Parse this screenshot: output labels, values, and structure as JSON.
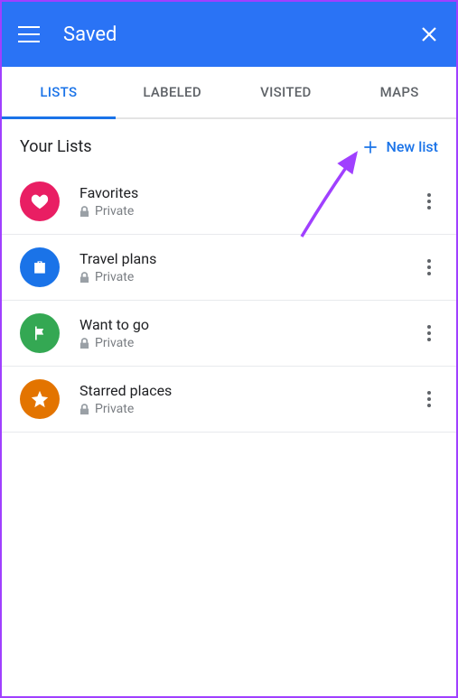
{
  "header": {
    "title": "Saved"
  },
  "tabs": [
    {
      "label": "LISTS",
      "active": true
    },
    {
      "label": "LABELED",
      "active": false
    },
    {
      "label": "VISITED",
      "active": false
    },
    {
      "label": "MAPS",
      "active": false
    }
  ],
  "section": {
    "title": "Your Lists",
    "new_list_label": "New list"
  },
  "lists": [
    {
      "name": "Favorites",
      "privacy": "Private",
      "icon": "heart",
      "color": "#e91e63"
    },
    {
      "name": "Travel plans",
      "privacy": "Private",
      "icon": "suitcase",
      "color": "#1a73e8"
    },
    {
      "name": "Want to go",
      "privacy": "Private",
      "icon": "flag",
      "color": "#34a853"
    },
    {
      "name": "Starred places",
      "privacy": "Private",
      "icon": "star",
      "color": "#e37400"
    }
  ]
}
